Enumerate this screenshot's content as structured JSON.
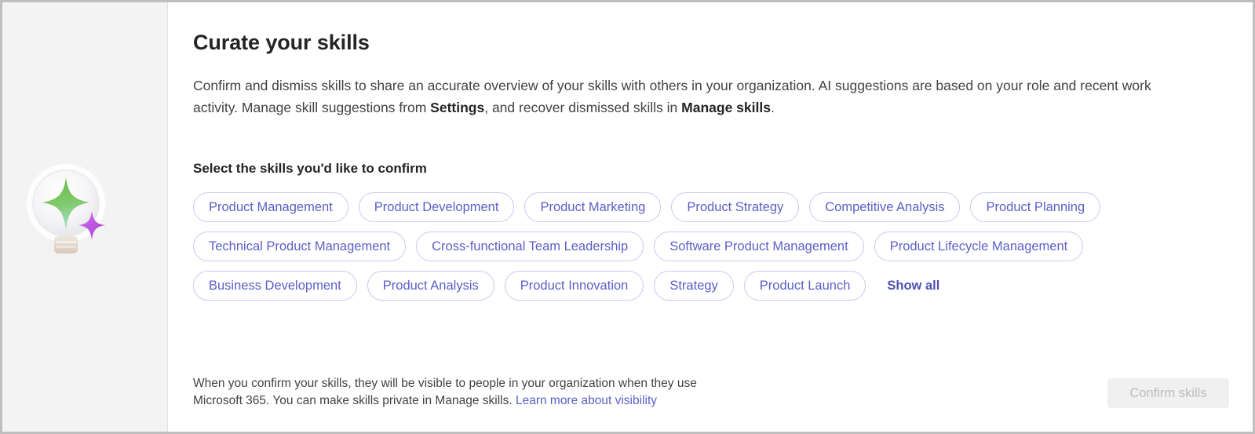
{
  "panel": {
    "title": "Curate your skills",
    "intro": {
      "part1": "Confirm and dismiss skills to share an accurate overview of your skills with others in your organization. AI suggestions are based on your role and recent work activity. Manage skill suggestions from ",
      "bold1": "Settings",
      "part2": ", and recover dismissed skills in  ",
      "bold2": "Manage skills",
      "part3": "."
    },
    "section_label": "Select the skills you'd like to confirm"
  },
  "illustration": {
    "name": "lightbulb-sparkle-illustration",
    "bulb_color": "#f4f4f6",
    "sparkle_primary": "#6bbf59",
    "sparkle_primary_end": "#9fd9c9",
    "sparkle_secondary": "#c05ce0"
  },
  "skills": {
    "rows": [
      [
        {
          "label": "Product Management"
        },
        {
          "label": "Product Development"
        },
        {
          "label": "Product Marketing"
        },
        {
          "label": "Product Strategy"
        },
        {
          "label": "Competitive Analysis"
        },
        {
          "label": "Product Planning"
        }
      ],
      [
        {
          "label": "Technical Product Management"
        },
        {
          "label": "Cross-functional Team Leadership"
        },
        {
          "label": "Software Product Management"
        },
        {
          "label": "Product Lifecycle Management"
        }
      ],
      [
        {
          "label": "Business Development"
        },
        {
          "label": "Product Analysis"
        },
        {
          "label": "Product Innovation"
        },
        {
          "label": "Strategy"
        },
        {
          "label": "Product Launch"
        }
      ]
    ],
    "show_all_label": "Show all"
  },
  "footer": {
    "line1": "When you confirm your skills, they will be visible to people in your organization when they use",
    "line2": "Microsoft 365. You can make skills private in Manage skills. ",
    "link_label": "Learn more about visibility",
    "confirm_button_label": "Confirm skills"
  },
  "colors": {
    "chip_border": "#c8caf0",
    "chip_text": "#5b5fc7",
    "link": "#5b5fc7",
    "rail_bg": "#f3f3f3",
    "disabled_button_bg": "#f0f0f0"
  }
}
